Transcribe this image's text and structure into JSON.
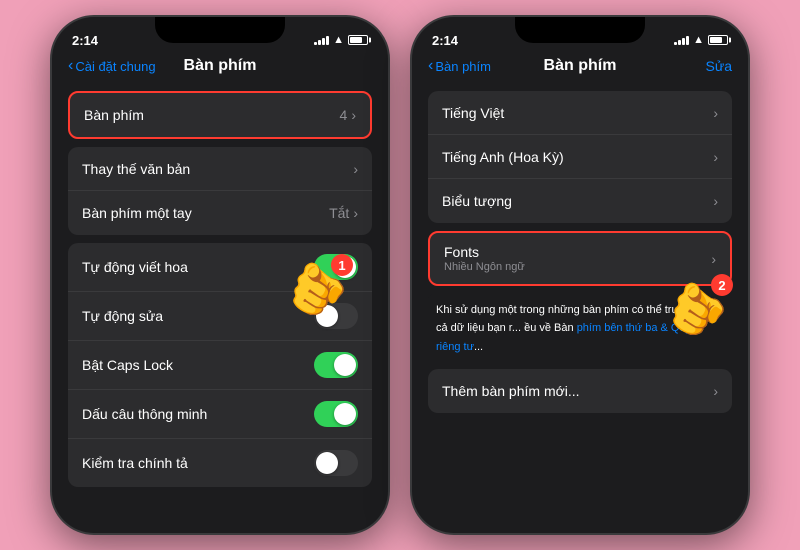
{
  "background_color": "#f0a0b8",
  "phone1": {
    "status_time": "2:14",
    "nav_back_label": "Cài đặt chung",
    "nav_title": "Bàn phím",
    "sections": [
      {
        "id": "keyboards-group",
        "highlighted": true,
        "items": [
          {
            "label": "Bàn phím",
            "value": "4",
            "has_chevron": true
          }
        ]
      },
      {
        "id": "text-group",
        "items": [
          {
            "label": "Thay thế văn bản",
            "has_chevron": true
          },
          {
            "label": "Bàn phím một tay",
            "value": "Tắt",
            "has_chevron": true
          }
        ]
      },
      {
        "id": "toggles-group",
        "items": [
          {
            "label": "Tự động viết hoa",
            "toggle": true,
            "toggle_on": true
          },
          {
            "label": "Tự động sửa",
            "toggle": true,
            "toggle_on": false
          },
          {
            "label": "Bật Caps Lock",
            "toggle": true,
            "toggle_on": true
          },
          {
            "label": "Dấu câu thông minh",
            "toggle": true,
            "toggle_on": true
          },
          {
            "label": "Kiểm tra chính tả",
            "toggle": true,
            "toggle_on": false
          }
        ]
      }
    ],
    "finger": {
      "badge": "1",
      "bottom": "220",
      "right": "60"
    }
  },
  "phone2": {
    "status_time": "2:14",
    "nav_back_label": "Bàn phím",
    "nav_title": "Bàn phím",
    "nav_action": "Sửa",
    "sections": [
      {
        "id": "keyboards-list",
        "items": [
          {
            "label": "Tiếng Việt",
            "has_chevron": true
          },
          {
            "label": "Tiếng Anh (Hoa Kỳ)",
            "has_chevron": true
          },
          {
            "label": "Biểu tượng",
            "has_chevron": true
          }
        ]
      },
      {
        "id": "fonts-group",
        "highlighted": true,
        "items": [
          {
            "label": "Fonts",
            "sublabel": "Nhiều Ngôn ngữ",
            "has_chevron": true
          }
        ]
      }
    ],
    "description": "Khi sử dụng một trong những bàn phím có thể truy cập tất cả dữ liệu bạn r... ều về Bàn phím bên thứ ba & Quyền riêng tư...",
    "add_keyboard": "Thêm bàn phím mới...",
    "finger": {
      "badge": "2",
      "bottom": "210",
      "right": "30"
    }
  }
}
